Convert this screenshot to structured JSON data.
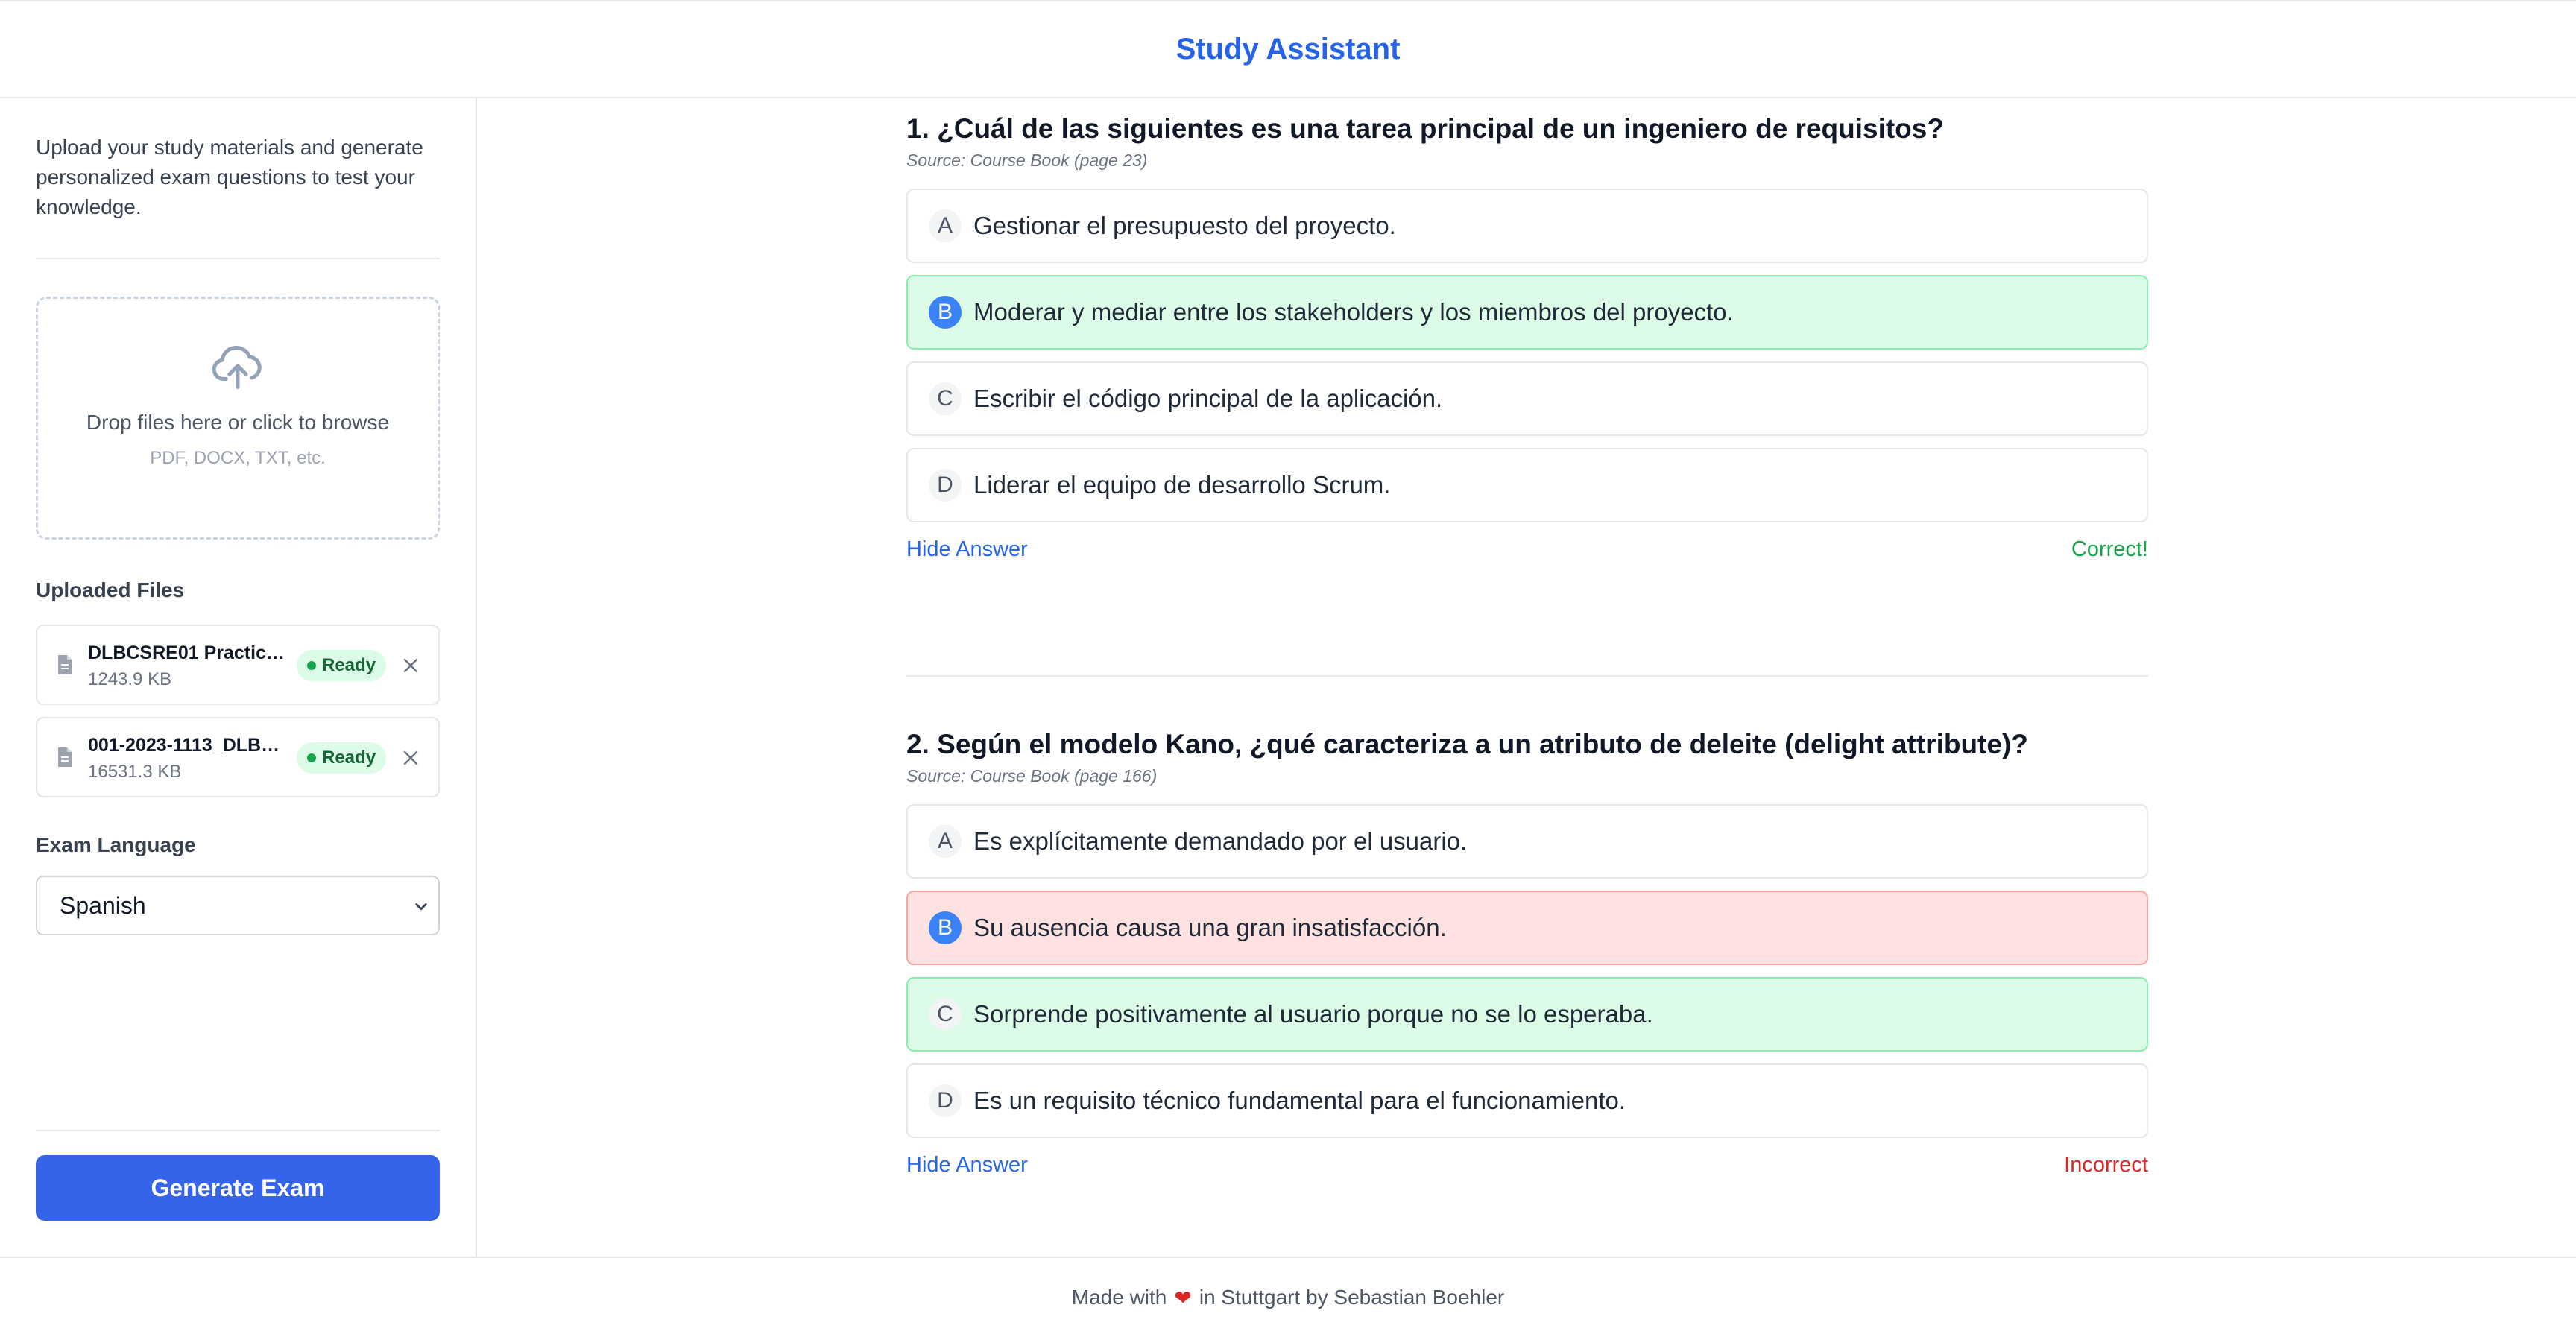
{
  "header": {
    "title": "Study Assistant"
  },
  "sidebar": {
    "intro": "Upload your study materials and generate personalized exam questions to test your knowledge.",
    "dropzone": {
      "text": "Drop files here or click to browse",
      "hint": "PDF, DOCX, TXT, etc."
    },
    "uploaded_label": "Uploaded Files",
    "files": [
      {
        "name": "DLBCSRE01 Practice ...",
        "size": "1243.9 KB",
        "status": "Ready"
      },
      {
        "name": "001-2023-1113_DLBC...",
        "size": "16531.3 KB",
        "status": "Ready"
      }
    ],
    "language_label": "Exam Language",
    "language_value": "Spanish",
    "generate_label": "Generate Exam"
  },
  "questions": [
    {
      "title": "1. ¿Cuál de las siguientes es una tarea principal de un ingeniero de requisitos?",
      "source": "Source: Course Book (page 23)",
      "options": [
        {
          "letter": "A",
          "text": "Gestionar el presupuesto del proyecto."
        },
        {
          "letter": "B",
          "text": "Moderar y mediar entre los stakeholders y los miembros del proyecto."
        },
        {
          "letter": "C",
          "text": "Escribir el código principal de la aplicación."
        },
        {
          "letter": "D",
          "text": "Liderar el equipo de desarrollo Scrum."
        }
      ],
      "hide_label": "Hide Answer",
      "result": "Correct!"
    },
    {
      "title": "2. Según el modelo Kano, ¿qué caracteriza a un atributo de deleite (delight attribute)?",
      "source": "Source: Course Book (page 166)",
      "options": [
        {
          "letter": "A",
          "text": "Es explícitamente demandado por el usuario."
        },
        {
          "letter": "B",
          "text": "Su ausencia causa una gran insatisfacción."
        },
        {
          "letter": "C",
          "text": "Sorprende positivamente al usuario porque no se lo esperaba."
        },
        {
          "letter": "D",
          "text": "Es un requisito técnico fundamental para el funcionamiento."
        }
      ],
      "hide_label": "Hide Answer",
      "result": "Incorrect"
    }
  ],
  "footer": {
    "before": "Made with",
    "heart": "❤",
    "after": "in Stuttgart by Sebastian Boehler"
  },
  "colors": {
    "accent": "#2563eb",
    "button": "#3563e9",
    "correct_bg": "#dcfce7",
    "wrong_bg": "#fee2e2",
    "correct_text": "#16a34a",
    "wrong_text": "#dc2626"
  }
}
